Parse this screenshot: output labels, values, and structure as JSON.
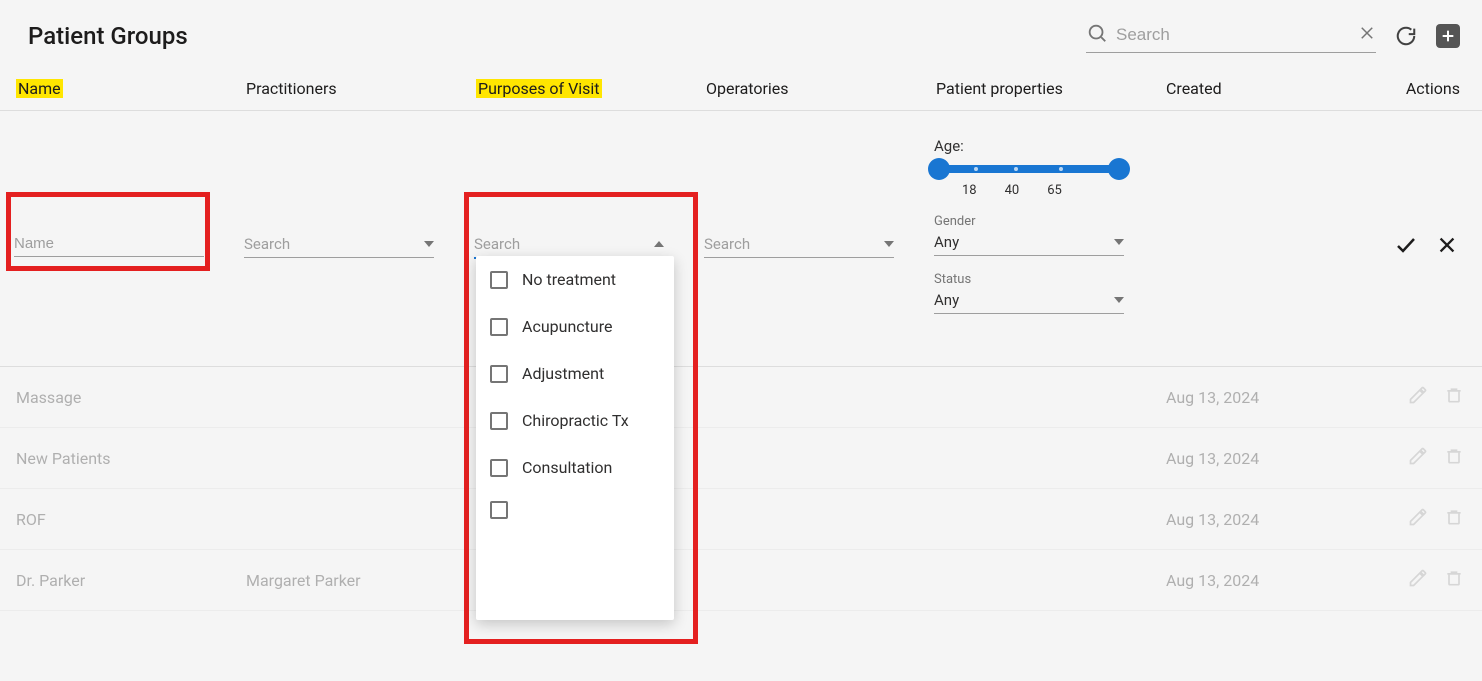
{
  "header": {
    "title": "Patient Groups",
    "search_placeholder": "Search"
  },
  "columns": {
    "name": "Name",
    "practitioners": "Practitioners",
    "purposes": "Purposes of Visit",
    "operatories": "Operatories",
    "properties": "Patient properties",
    "created": "Created",
    "actions": "Actions"
  },
  "editor": {
    "name_placeholder": "Name",
    "search_placeholder": "Search",
    "age_label": "Age:",
    "age_ticks": [
      "18",
      "40",
      "65"
    ],
    "gender_label": "Gender",
    "gender_value": "Any",
    "status_label": "Status",
    "status_value": "Any"
  },
  "purpose_options": [
    "No treatment",
    "Acupuncture",
    "Adjustment",
    "Chiropractic Tx",
    "Consultation"
  ],
  "rows": [
    {
      "name": "Massage",
      "practitioner": "",
      "created": "Aug 13, 2024"
    },
    {
      "name": "New Patients",
      "practitioner": "",
      "created": "Aug 13, 2024"
    },
    {
      "name": "ROF",
      "practitioner": "",
      "created": "Aug 13, 2024"
    },
    {
      "name": "Dr. Parker",
      "practitioner": "Margaret Parker",
      "created": "Aug 13, 2024"
    }
  ]
}
